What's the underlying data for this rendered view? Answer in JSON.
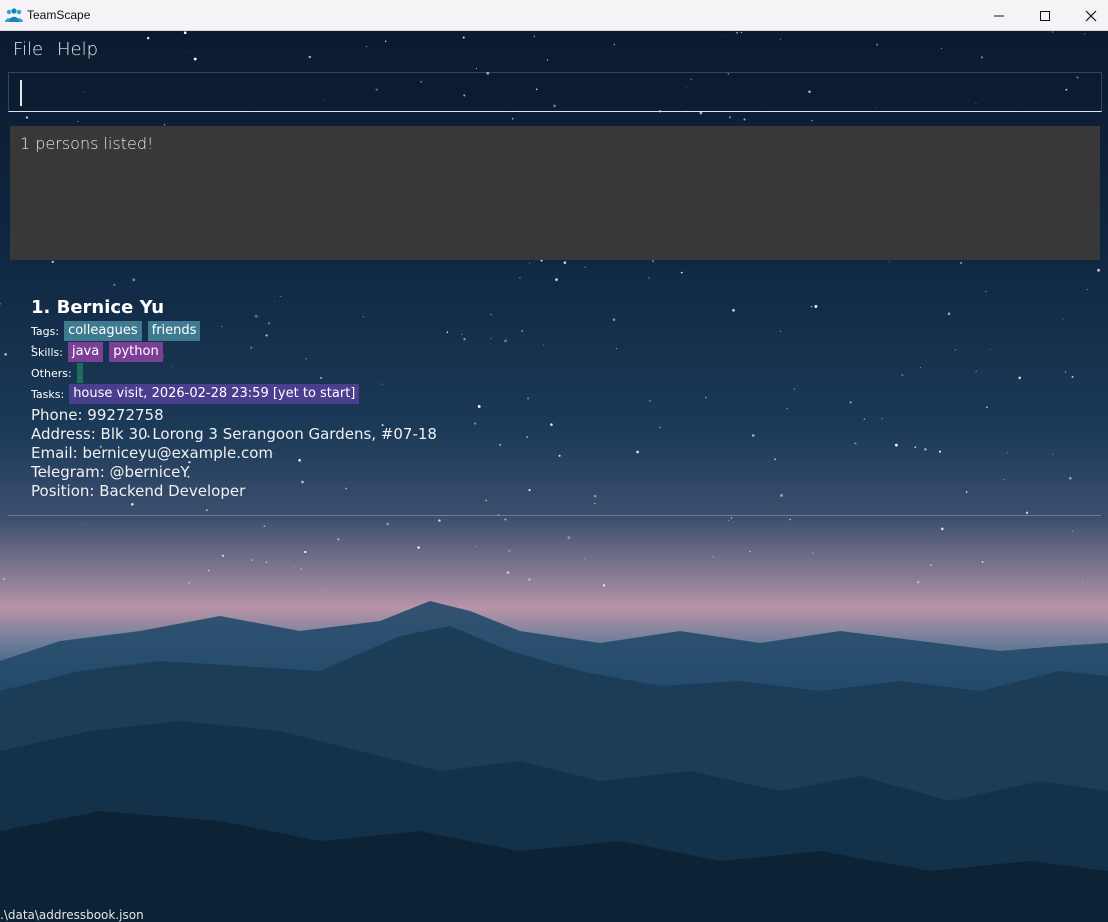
{
  "window": {
    "title": "TeamScape"
  },
  "menu": {
    "items": [
      {
        "label": "File"
      },
      {
        "label": "Help"
      }
    ]
  },
  "command_box": {
    "value": "",
    "placeholder": ""
  },
  "result": {
    "text": "1 persons listed!"
  },
  "persons": [
    {
      "name": "1. Bernice Yu",
      "tags_label": "Tags:",
      "tags": [
        "colleagues",
        "friends"
      ],
      "skills_label": "Skills:",
      "skills": [
        "java",
        "python"
      ],
      "others_label": "Others:",
      "tasks_label": "Tasks:",
      "tasks": [
        "house visit, 2026-02-28 23:59 [yet to start]"
      ],
      "phone": "Phone: 99272758",
      "address": "Address: Blk 30 Lorong 3 Serangoon Gardens, #07-18",
      "email": "Email: berniceyu@example.com",
      "telegram": "Telegram: @berniceY",
      "position": "Position: Backend Developer"
    }
  ],
  "status_bar": {
    "path": ".\\data\\addressbook.json"
  },
  "colors": {
    "tag": "#3e7b91",
    "skill": "#7b3f95",
    "task": "#4a3f8f",
    "other": "#1c6e5c",
    "result_bg": "#383838"
  },
  "icons": [
    "app-icon",
    "minimize-icon",
    "maximize-icon",
    "close-icon"
  ]
}
